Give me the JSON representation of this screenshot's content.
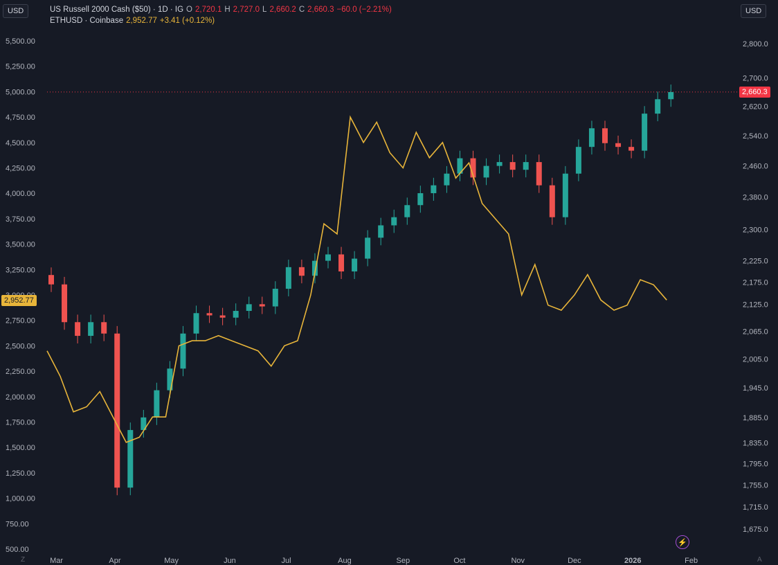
{
  "legend": {
    "primary": {
      "symbol": "US Russell 2000 Cash ($50) · 1D · IG",
      "o_label": "O",
      "o_value": "2,720.1",
      "h_label": "H",
      "h_value": "2,727.0",
      "l_label": "L",
      "l_value": "2,660.2",
      "c_label": "C",
      "c_value": "2,660.3",
      "change": "−60.0 (−2.21%)"
    },
    "secondary": {
      "symbol": "ETHUSD · Coinbase",
      "price": "2,952.77",
      "change": "+3.41 (+0.12%)"
    }
  },
  "left_unit": "USD",
  "right_unit": "USD",
  "left_price_tag": "2,952.77",
  "right_price_tag": "2,660.3",
  "corner_left": "Z",
  "corner_right": "A",
  "icons": {
    "bolt": "lightning-icon"
  },
  "colors": {
    "background": "#161a25",
    "up": "#26a69a",
    "down": "#ef5350",
    "eth_line": "#e8b53a",
    "last_price": "#f23645",
    "text": "#b2b5be"
  },
  "chart_data": {
    "type": "line",
    "x_tick_labels": [
      "Mar",
      "Apr",
      "May",
      "Jun",
      "Jul",
      "Aug",
      "Sep",
      "Oct",
      "Nov",
      "Dec",
      "2026",
      "Feb"
    ],
    "left_axis": {
      "unit": "USD",
      "ticks": [
        "5,500.00",
        "5,250.00",
        "5,000.00",
        "4,750.00",
        "4,500.00",
        "4,250.00",
        "4,000.00",
        "3,750.00",
        "3,500.00",
        "3,250.00",
        "3,000.00",
        "2,750.00",
        "2,500.00",
        "2,250.00",
        "2,000.00",
        "1,750.00",
        "1,500.00",
        "1,250.00",
        "1,000.00",
        "750.00",
        "500.00"
      ]
    },
    "right_axis": {
      "unit": "USD",
      "scale": "log",
      "ticks": [
        "2,800.0",
        "2,700.0",
        "2,620.0",
        "2,540.0",
        "2,460.0",
        "2,380.0",
        "2,300.0",
        "2,225.0",
        "2,175.0",
        "2,125.0",
        "2,065.0",
        "2,005.0",
        "1,945.0",
        "1,885.0",
        "1,835.0",
        "1,795.0",
        "1,755.0",
        "1,715.0",
        "1,675.0"
      ]
    },
    "series": [
      {
        "name": "US Russell 2000 Cash ($50)",
        "axis": "right",
        "style": "candlestick",
        "dates": [
          "2025-02-24",
          "2025-03-03",
          "2025-03-10",
          "2025-03-17",
          "2025-03-24",
          "2025-03-31",
          "2025-04-07",
          "2025-04-14",
          "2025-04-21",
          "2025-04-28",
          "2025-05-05",
          "2025-05-12",
          "2025-05-19",
          "2025-05-26",
          "2025-06-02",
          "2025-06-09",
          "2025-06-16",
          "2025-06-23",
          "2025-06-30",
          "2025-07-07",
          "2025-07-14",
          "2025-07-21",
          "2025-07-28",
          "2025-08-04",
          "2025-08-11",
          "2025-08-18",
          "2025-08-25",
          "2025-09-01",
          "2025-09-08",
          "2025-09-15",
          "2025-09-22",
          "2025-09-29",
          "2025-10-06",
          "2025-10-13",
          "2025-10-20",
          "2025-10-27",
          "2025-11-03",
          "2025-11-10",
          "2025-11-17",
          "2025-11-24",
          "2025-12-01",
          "2025-12-08",
          "2025-12-15",
          "2025-12-22",
          "2025-12-29",
          "2026-01-05",
          "2026-01-12",
          "2026-01-19"
        ],
        "close": [
          2170,
          2085,
          2055,
          2085,
          2060,
          1750,
          1860,
          1885,
          1940,
          1985,
          2060,
          2105,
          2100,
          2095,
          2110,
          2125,
          2120,
          2160,
          2210,
          2190,
          2225,
          2240,
          2200,
          2230,
          2280,
          2310,
          2330,
          2360,
          2390,
          2410,
          2440,
          2480,
          2430,
          2460,
          2470,
          2450,
          2470,
          2410,
          2330,
          2440,
          2510,
          2560,
          2520,
          2510,
          2500,
          2600,
          2640,
          2660
        ]
      },
      {
        "name": "ETHUSD · Coinbase",
        "axis": "left",
        "style": "line",
        "dates": [
          "2025-02-24",
          "2025-03-03",
          "2025-03-10",
          "2025-03-17",
          "2025-03-24",
          "2025-03-31",
          "2025-04-07",
          "2025-04-14",
          "2025-04-21",
          "2025-04-28",
          "2025-05-05",
          "2025-05-12",
          "2025-05-19",
          "2025-05-26",
          "2025-06-02",
          "2025-06-09",
          "2025-06-16",
          "2025-06-23",
          "2025-06-30",
          "2025-07-07",
          "2025-07-14",
          "2025-07-21",
          "2025-07-28",
          "2025-08-04",
          "2025-08-11",
          "2025-08-18",
          "2025-08-25",
          "2025-09-01",
          "2025-09-08",
          "2025-09-15",
          "2025-09-22",
          "2025-09-29",
          "2025-10-06",
          "2025-10-13",
          "2025-10-20",
          "2025-10-27",
          "2025-11-03",
          "2025-11-10",
          "2025-11-17",
          "2025-11-24",
          "2025-12-01",
          "2025-12-08",
          "2025-12-15",
          "2025-12-22",
          "2025-12-29",
          "2026-01-05",
          "2026-01-12",
          "2026-01-19"
        ],
        "values": [
          2450,
          2200,
          1850,
          1900,
          2050,
          1800,
          1550,
          1600,
          1800,
          1800,
          2500,
          2550,
          2550,
          2600,
          2550,
          2500,
          2450,
          2300,
          2500,
          2550,
          3000,
          3700,
          3600,
          4750,
          4500,
          4700,
          4400,
          4250,
          4600,
          4350,
          4500,
          4150,
          4300,
          3900,
          3750,
          3600,
          3000,
          3300,
          2900,
          2850,
          3000,
          3200,
          2950,
          2850,
          2900,
          3150,
          3100,
          2950
        ]
      }
    ]
  }
}
